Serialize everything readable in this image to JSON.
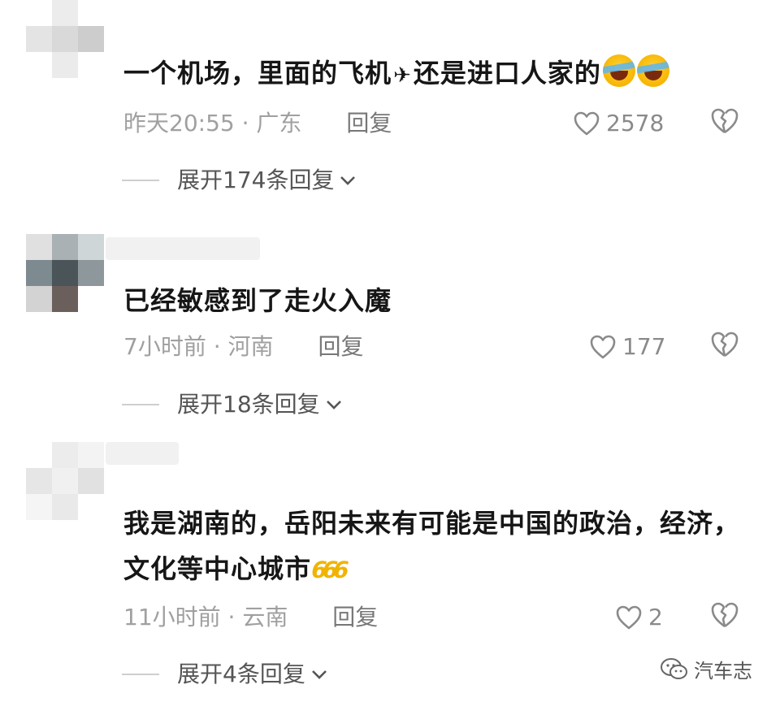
{
  "comments": [
    {
      "text_before": "一个机场，里面的飞机",
      "text_after": "还是进口人家的",
      "time": "昨天20:55",
      "location": "广东",
      "reply_label": "回复",
      "likes": "2578",
      "expand_label": "展开174条回复",
      "inline_icons": [
        "airplane-emoji",
        "laughing-crying-emoji",
        "laughing-crying-emoji"
      ]
    },
    {
      "text": "已经敏感到了走火入魔",
      "time": "7小时前",
      "location": "河南",
      "reply_label": "回复",
      "likes": "177",
      "expand_label": "展开18条回复"
    },
    {
      "text": "我是湖南的，岳阳未来有可能是中国的政治，经济，文化等中心城市",
      "time": "11小时前",
      "location": "云南",
      "reply_label": "回复",
      "likes": "2",
      "expand_label": "展开4条回复",
      "inline_icons": [
        "666-emoji"
      ]
    }
  ],
  "separator": "·",
  "watermark": "汽车志",
  "colors": {
    "text": "#161616",
    "meta": "#a0a0a0",
    "reply": "#777777",
    "icon": "#8a8a8a",
    "emoji_yellow": "#f7b500"
  }
}
